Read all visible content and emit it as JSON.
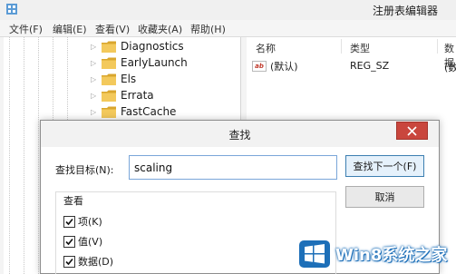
{
  "window": {
    "title": "注册表编辑器"
  },
  "menu": [
    "文件(F)",
    "编辑(E)",
    "查看(V)",
    "收藏夹(A)",
    "帮助(H)"
  ],
  "tree": {
    "items": [
      {
        "label": "Diagnostics"
      },
      {
        "label": "EarlyLaunch"
      },
      {
        "label": "Els"
      },
      {
        "label": "Errata"
      },
      {
        "label": "FastCache"
      }
    ]
  },
  "list": {
    "headers": {
      "name": "名称",
      "type": "类型",
      "data": "数据"
    },
    "rows": [
      {
        "name": "(默认)",
        "type": "REG_SZ",
        "data": "(数"
      }
    ]
  },
  "dialog": {
    "title": "查找",
    "find_label": "查找目标(N):",
    "find_value": "scaling",
    "find_next_button": "查找下一个(F)",
    "cancel_button": "取消",
    "look_at_label": "查看",
    "options": [
      {
        "label": "项(K)",
        "checked": true
      },
      {
        "label": "值(V)",
        "checked": true
      },
      {
        "label": "数据(D)",
        "checked": true
      }
    ]
  },
  "watermark": {
    "text": "Win8系统之家"
  },
  "colors": {
    "accent": "#3c7fb1",
    "close": "#c9463d",
    "folder": "#e8b73a",
    "watermark": "#1d6fb8"
  },
  "icons": [
    "regedit-icon",
    "folder-icon",
    "string-value-icon",
    "close-icon",
    "checkmark-icon",
    "windows-logo-icon"
  ]
}
